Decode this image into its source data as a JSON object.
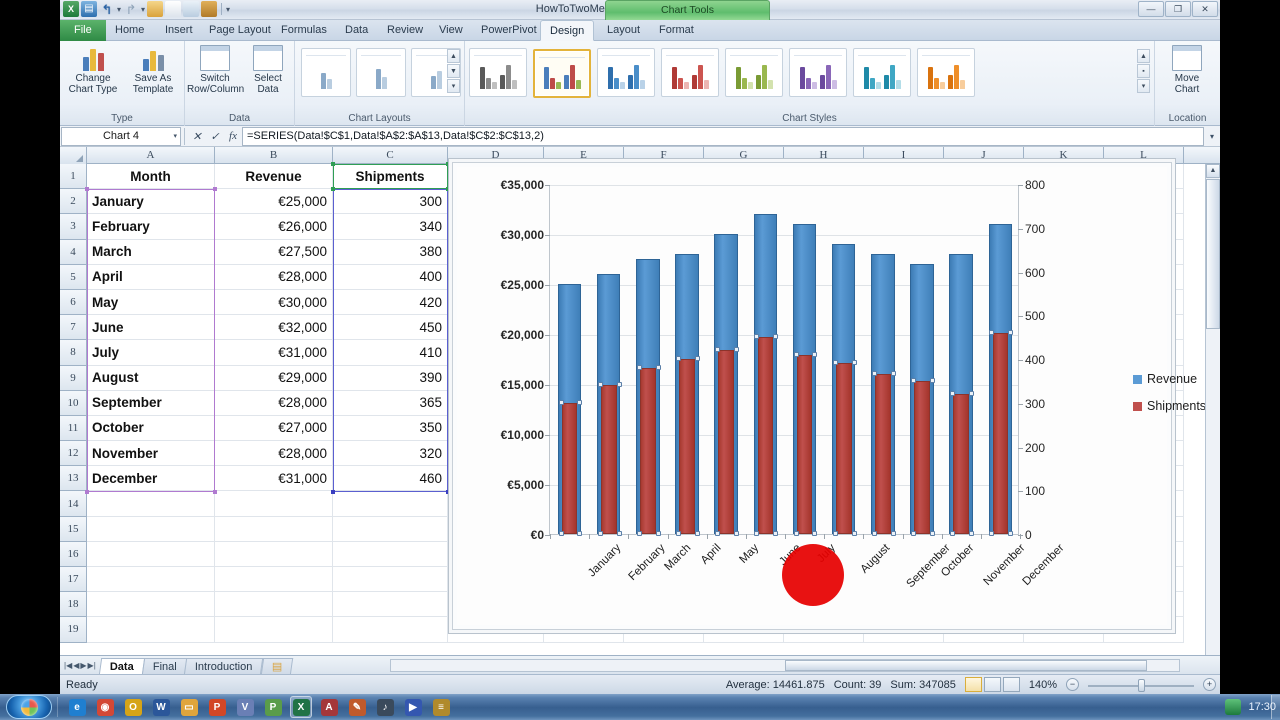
{
  "window": {
    "title": "HowToTwoMeasures.xlsx - Microsoft Excel",
    "contextual_tab_group": "Chart Tools",
    "minimize": "—",
    "restore": "❐",
    "close": "✕",
    "quick_access": [
      "excel-icon",
      "save-icon",
      "undo-icon",
      "redo-icon",
      "open-icon",
      "new-icon",
      "print-preview-icon",
      "customize-icon"
    ]
  },
  "ribbon": {
    "tabs": [
      {
        "label": "File",
        "active": false,
        "file": true
      },
      {
        "label": "Home",
        "active": false
      },
      {
        "label": "Insert",
        "active": false
      },
      {
        "label": "Page Layout",
        "active": false
      },
      {
        "label": "Formulas",
        "active": false
      },
      {
        "label": "Data",
        "active": false
      },
      {
        "label": "Review",
        "active": false
      },
      {
        "label": "View",
        "active": false
      },
      {
        "label": "PowerPivot",
        "active": false
      },
      {
        "label": "Design",
        "active": true
      },
      {
        "label": "Layout",
        "active": false
      },
      {
        "label": "Format",
        "active": false
      }
    ],
    "groups": [
      {
        "name": "Type",
        "buttons": [
          {
            "l1": "Change",
            "l2": "Chart Type"
          },
          {
            "l1": "Save As",
            "l2": "Template"
          }
        ]
      },
      {
        "name": "Data",
        "buttons": [
          {
            "l1": "Switch",
            "l2": "Row/Column"
          },
          {
            "l1": "Select",
            "l2": "Data"
          }
        ]
      },
      {
        "name": "Chart Layouts",
        "buttons": []
      },
      {
        "name": "Chart Styles",
        "buttons": []
      },
      {
        "name": "Location",
        "buttons": [
          {
            "l1": "Move",
            "l2": "Chart"
          }
        ]
      }
    ],
    "chart_styles": [
      {
        "selected": false,
        "colors": [
          "#5a5a5a",
          "#8c8c8c",
          "#bfbfbf"
        ]
      },
      {
        "selected": true,
        "colors": [
          "#4a7ebb",
          "#be4b48",
          "#98b954"
        ]
      },
      {
        "selected": false,
        "colors": [
          "#2f6fad",
          "#4a8ec9",
          "#b9d2e8"
        ]
      },
      {
        "selected": false,
        "colors": [
          "#b03a36",
          "#cc5550",
          "#ecb6b3"
        ]
      },
      {
        "selected": false,
        "colors": [
          "#7a9b34",
          "#9ab84f",
          "#d3e2ae"
        ]
      },
      {
        "selected": false,
        "colors": [
          "#6b4a9e",
          "#8a67b8",
          "#cdbce4"
        ]
      },
      {
        "selected": false,
        "colors": [
          "#1f8aa8",
          "#3fa7c4",
          "#b3dde8"
        ]
      },
      {
        "selected": false,
        "colors": [
          "#d9730f",
          "#ef8f2a",
          "#f8cd9c"
        ]
      }
    ]
  },
  "formula_bar": {
    "name_box": "Chart 4",
    "formula": "=SERIES(Data!$C$1,Data!$A$2:$A$13,Data!$C$2:$C$13,2)",
    "fx_label": "fx",
    "insert_function_icon": "fx-icon"
  },
  "grid": {
    "columns": [
      "A",
      "B",
      "C",
      "D",
      "E",
      "F",
      "G",
      "H",
      "I",
      "J",
      "K",
      "L"
    ],
    "rows": [
      "1",
      "2",
      "3",
      "4",
      "5",
      "6",
      "7",
      "8",
      "9",
      "10",
      "11",
      "12",
      "13",
      "14",
      "15",
      "16",
      "17",
      "18",
      "19"
    ],
    "headers": [
      "Month",
      "Revenue",
      "Shipments"
    ],
    "data": [
      {
        "month": "January",
        "revenue": "€25,000",
        "shipments": "300"
      },
      {
        "month": "February",
        "revenue": "€26,000",
        "shipments": "340"
      },
      {
        "month": "March",
        "revenue": "€27,500",
        "shipments": "380"
      },
      {
        "month": "April",
        "revenue": "€28,000",
        "shipments": "400"
      },
      {
        "month": "May",
        "revenue": "€30,000",
        "shipments": "420"
      },
      {
        "month": "June",
        "revenue": "€32,000",
        "shipments": "450"
      },
      {
        "month": "July",
        "revenue": "€31,000",
        "shipments": "410"
      },
      {
        "month": "August",
        "revenue": "€29,000",
        "shipments": "390"
      },
      {
        "month": "September",
        "revenue": "€28,000",
        "shipments": "365"
      },
      {
        "month": "October",
        "revenue": "€27,000",
        "shipments": "350"
      },
      {
        "month": "November",
        "revenue": "€28,000",
        "shipments": "320"
      },
      {
        "month": "December",
        "revenue": "€31,000",
        "shipments": "460"
      }
    ]
  },
  "chart_data": {
    "type": "bar",
    "title": "",
    "categories": [
      "January",
      "February",
      "March",
      "April",
      "May",
      "June",
      "July",
      "August",
      "September",
      "October",
      "November",
      "December"
    ],
    "series": [
      {
        "name": "Revenue",
        "axis": "primary",
        "color": "#5b9bd5",
        "values": [
          25000,
          26000,
          27500,
          28000,
          30000,
          32000,
          31000,
          29000,
          28000,
          27000,
          28000,
          31000
        ]
      },
      {
        "name": "Shipments",
        "axis": "secondary",
        "color": "#c0504d",
        "values": [
          300,
          340,
          380,
          400,
          420,
          450,
          410,
          390,
          365,
          350,
          320,
          460
        ]
      }
    ],
    "y_primary": {
      "label": "",
      "ticks": [
        "€0",
        "€5,000",
        "€10,000",
        "€15,000",
        "€20,000",
        "€25,000",
        "€30,000",
        "€35,000"
      ],
      "min": 0,
      "max": 35000,
      "step": 5000
    },
    "y_secondary": {
      "label": "",
      "ticks": [
        "0",
        "100",
        "200",
        "300",
        "400",
        "500",
        "600",
        "700",
        "800"
      ],
      "min": 0,
      "max": 800,
      "step": 100
    },
    "xlabel": "",
    "grid": true,
    "legend_position": "right",
    "legend": [
      "Revenue",
      "Shipments"
    ]
  },
  "sheet_tabs": {
    "nav_icons": [
      "first-sheet-icon",
      "prev-sheet-icon",
      "next-sheet-icon",
      "last-sheet-icon"
    ],
    "tabs": [
      {
        "label": "Data",
        "active": true
      },
      {
        "label": "Final",
        "active": false
      },
      {
        "label": "Introduction",
        "active": false
      }
    ],
    "new_sheet_icon": "new-sheet-icon"
  },
  "status_bar": {
    "mode": "Ready",
    "average": "Average: 14461.875",
    "count": "Count: 39",
    "sum": "Sum: 347085",
    "zoom": "140%",
    "zoom_out": "−",
    "zoom_in": "+",
    "views": [
      "normal-view-icon",
      "page-layout-view-icon",
      "page-break-view-icon"
    ]
  },
  "taskbar": {
    "start": "start-orb-icon",
    "items": [
      {
        "name": "internet-explorer-icon",
        "glyph": "e",
        "color": "#1f7fd0"
      },
      {
        "name": "chrome-icon",
        "glyph": "◉",
        "color": "#d34836"
      },
      {
        "name": "opera-icon",
        "glyph": "O",
        "color": "#d6a417"
      },
      {
        "name": "word-icon",
        "glyph": "W",
        "color": "#2b579a"
      },
      {
        "name": "folder-icon",
        "glyph": "▭",
        "color": "#e0a53c"
      },
      {
        "name": "powerpoint-icon",
        "glyph": "P",
        "color": "#d24726"
      },
      {
        "name": "visio-icon",
        "glyph": "V",
        "color": "#6a7fb5"
      },
      {
        "name": "project-icon",
        "glyph": "P",
        "color": "#5a9c4a"
      },
      {
        "name": "excel-icon",
        "glyph": "X",
        "color": "#217346",
        "active": true
      },
      {
        "name": "access-icon",
        "glyph": "A",
        "color": "#a4373a"
      },
      {
        "name": "paint-icon",
        "glyph": "✎",
        "color": "#c05a2c"
      },
      {
        "name": "headset-icon",
        "glyph": "♪",
        "color": "#3a4a5c"
      },
      {
        "name": "media-icon",
        "glyph": "▶",
        "color": "#3457b0"
      },
      {
        "name": "notes-icon",
        "glyph": "≡",
        "color": "#b08a2c"
      }
    ],
    "clock": "17:30",
    "show-desktop": "show-desktop-button"
  }
}
